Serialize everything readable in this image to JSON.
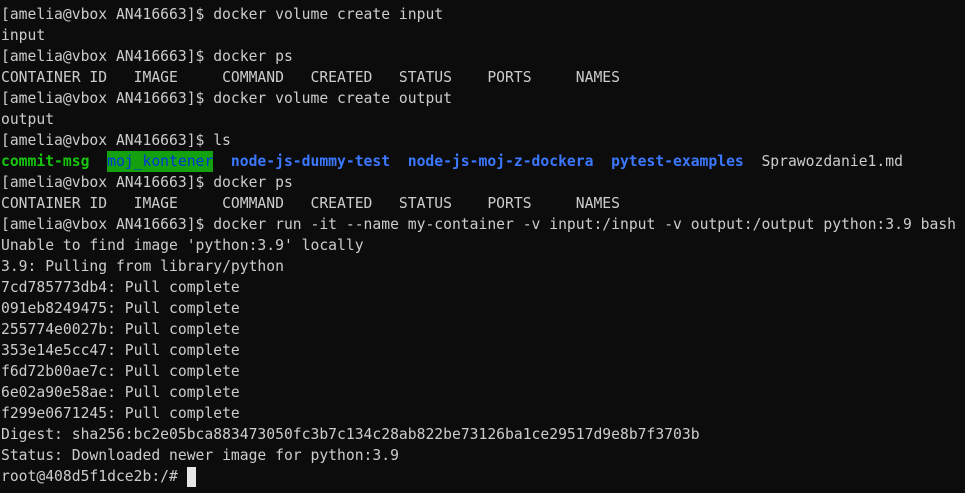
{
  "colors": {
    "background": "#0c0c0c",
    "foreground": "#cccccc",
    "executable": "#16c60c",
    "directory": "#3b78ff",
    "sticky_dir_bg": "#13a10e",
    "sticky_dir_fg": "#0037da",
    "cursor": "#e6e6e6"
  },
  "terminal": {
    "prompt": "[amelia@vbox AN416663]$",
    "container_prompt": "root@408d5f1dce2b:/#",
    "lines": [
      {
        "command": "docker volume create input"
      },
      {
        "output": "input"
      },
      {
        "command": "docker ps"
      },
      {
        "output": "CONTAINER ID   IMAGE     COMMAND   CREATED   STATUS    PORTS     NAMES"
      },
      {
        "command": "docker volume create output"
      },
      {
        "output": "output"
      },
      {
        "command": "ls"
      },
      {
        "entries": [
          "commit-msg",
          "moj_kontener",
          "node-js-dummy-test",
          "node-js-moj-z-dockera",
          "pytest-examples",
          "Sprawozdanie1.md"
        ]
      },
      {
        "command": "docker ps"
      },
      {
        "output": "CONTAINER ID   IMAGE     COMMAND   CREATED   STATUS    PORTS     NAMES"
      },
      {
        "command": "docker run -it --name my-container -v input:/input -v output:/output python:3.9 bash"
      },
      {
        "output": "Unable to find image 'python:3.9' locally"
      },
      {
        "output": "3.9: Pulling from library/python"
      },
      {
        "output": "7cd785773db4: Pull complete"
      },
      {
        "output": "091eb8249475: Pull complete"
      },
      {
        "output": "255774e0027b: Pull complete"
      },
      {
        "output": "353e14e5cc47: Pull complete"
      },
      {
        "output": "f6d72b00ae7c: Pull complete"
      },
      {
        "output": "6e02a90e58ae: Pull complete"
      },
      {
        "output": "f299e0671245: Pull complete"
      },
      {
        "output": "Digest: sha256:bc2e05bca883473050fc3b7c134c28ab822be73126ba1ce29517d9e8b7f3703b"
      },
      {
        "output": "Status: Downloaded newer image for python:3.9"
      }
    ]
  }
}
